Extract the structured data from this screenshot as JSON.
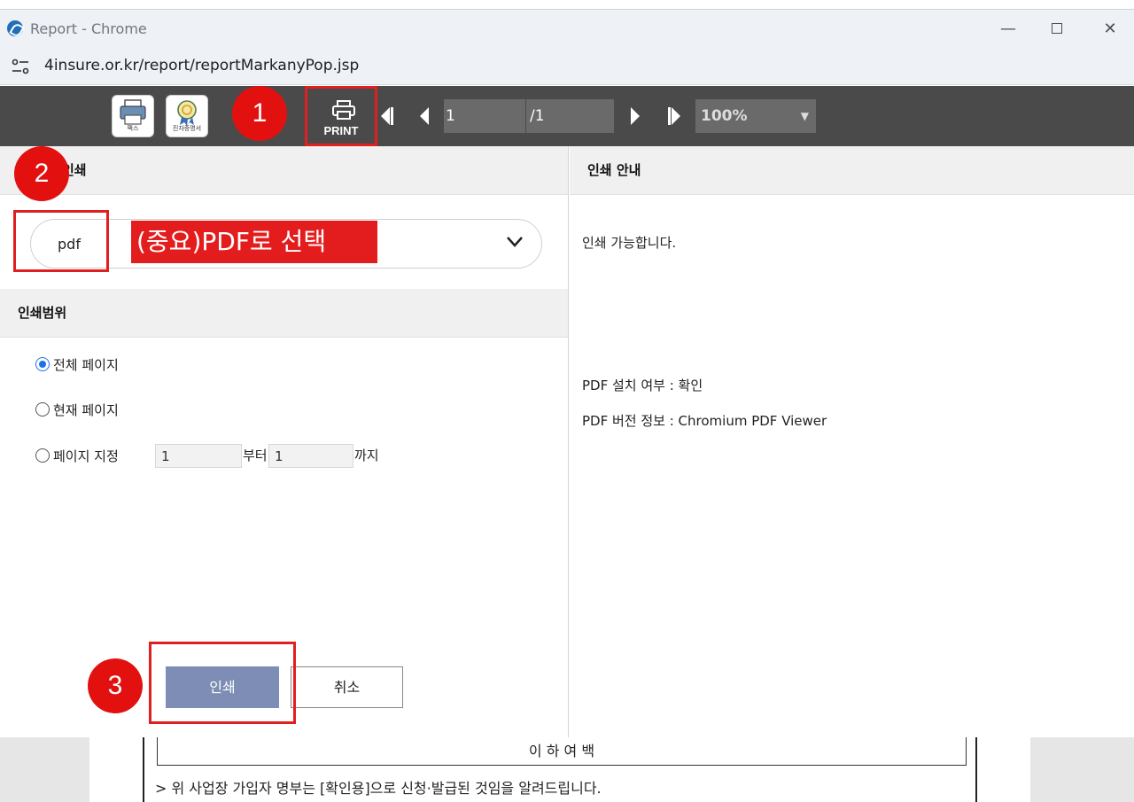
{
  "window": {
    "title": "Report - Chrome",
    "url": "4insure.or.kr/report/reportMarkanyPop.jsp"
  },
  "toolbar": {
    "fax_label": "팩스",
    "cert_label": "진자증명서",
    "print_label": "PRINT",
    "current_page": "1",
    "total_pages": "/1",
    "zoom": "100%"
  },
  "left": {
    "printer_header": "인쇄",
    "printer_value": "pdf",
    "annotation_banner": "(중요)PDF로 선택",
    "range_header": "인쇄범위",
    "range_options": [
      "전체 페이지",
      "현재 페이지",
      "페이지 지정"
    ],
    "selected_range": 0,
    "from_value": "1",
    "from_suffix": "부터",
    "to_value": "1",
    "to_suffix": "까지",
    "print_button": "인쇄",
    "cancel_button": "취소"
  },
  "right": {
    "header": "인쇄 안내",
    "status": "인쇄 가능합니다.",
    "pdf_installed": "PDF 설치 여부 : 확인",
    "pdf_version": "PDF 버전 정보 : Chromium PDF Viewer"
  },
  "annotations": {
    "step1": "1",
    "step2": "2",
    "step3": "3"
  },
  "document": {
    "blank_note": "이 하 여 백",
    "notice": "> 위 사업장 가입자 명부는 [확인용]으로 신청·발급된 것임을 알려드립니다."
  }
}
